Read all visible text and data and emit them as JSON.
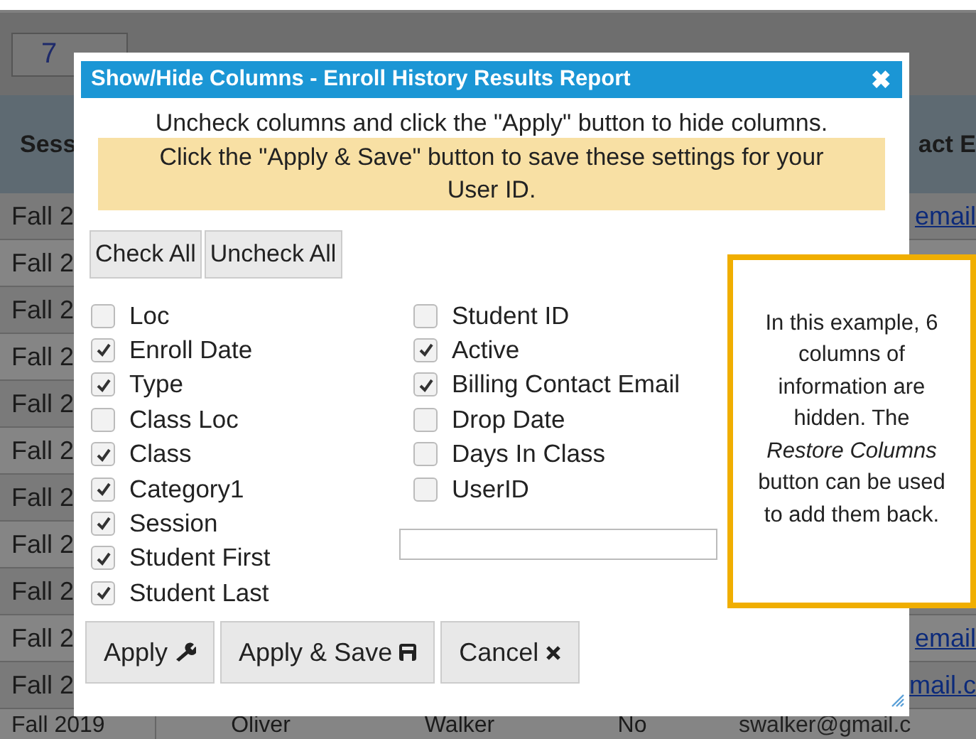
{
  "background": {
    "toolbar_text": "7",
    "headers": [
      "Sess",
      "act E"
    ],
    "rows": [
      {
        "session": "Fall 2",
        "email": "email"
      },
      {
        "session": "Fall 2"
      },
      {
        "session": "Fall 2"
      },
      {
        "session": "Fall 2"
      },
      {
        "session": "Fall 2"
      },
      {
        "session": "Fall 2"
      },
      {
        "session": "Fall 2"
      },
      {
        "session": "Fall 2"
      },
      {
        "session": "Fall 2"
      },
      {
        "session": "Fall 2",
        "email": "email"
      },
      {
        "session": "Fall 2",
        "email": "mail.c"
      }
    ],
    "last_row": [
      "Fall 2019",
      "Oliver",
      "Walker",
      "No",
      "swalker@gmail.c"
    ]
  },
  "dialog": {
    "title": "Show/Hide Columns - Enroll History Results Report",
    "close": "✖",
    "instruction": "Uncheck columns and click the \"Apply\" button to hide columns.",
    "note": "Click the \"Apply & Save\" button to save these settings for your User ID.",
    "check_all": "Check All",
    "uncheck_all": "Uncheck All",
    "columns_left": [
      {
        "label": "Loc",
        "checked": false
      },
      {
        "label": "Enroll Date",
        "checked": true
      },
      {
        "label": "Type",
        "checked": true
      },
      {
        "label": "Class Loc",
        "checked": false
      },
      {
        "label": "Class",
        "checked": true
      },
      {
        "label": "Category1",
        "checked": true
      },
      {
        "label": "Session",
        "checked": true
      },
      {
        "label": "Student First",
        "checked": true
      },
      {
        "label": "Student Last",
        "checked": true
      }
    ],
    "columns_right": [
      {
        "label": "Student ID",
        "checked": false
      },
      {
        "label": "Active",
        "checked": true
      },
      {
        "label": "Billing Contact Email",
        "checked": true
      },
      {
        "label": "Drop Date",
        "checked": false
      },
      {
        "label": "Days In Class",
        "checked": false
      },
      {
        "label": "UserID",
        "checked": false
      }
    ],
    "buttons": [
      {
        "label": "Apply"
      },
      {
        "label": "Apply & Save"
      },
      {
        "label": "Cancel"
      }
    ]
  },
  "callout": {
    "text": "In this example, 6 columns of information are hidden. The *Restore Columns* button can be used to add them back."
  }
}
